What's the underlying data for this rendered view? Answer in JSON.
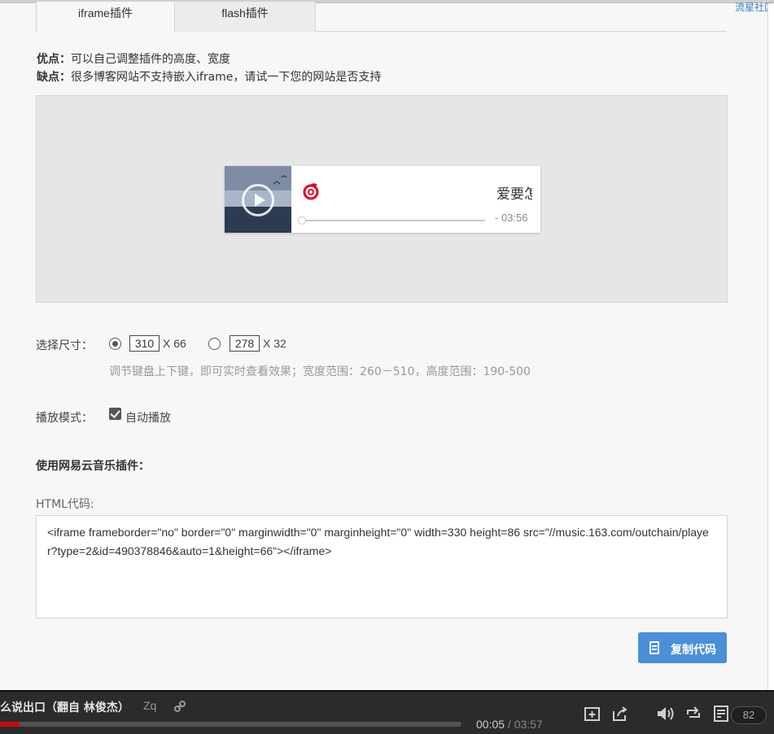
{
  "corner": {
    "link_text": "流星社区"
  },
  "tabs": [
    {
      "label": "iframe插件",
      "active": true
    },
    {
      "label": "flash插件",
      "active": false
    }
  ],
  "pros": {
    "adv_label": "优点：",
    "adv_text": "可以自己调整插件的高度、宽度",
    "dis_label": "缺点：",
    "dis_text": "很多博客网站不支持嵌入iframe，请试一下您的网站是否支持"
  },
  "player": {
    "title": "爱要怎么说出口",
    "time": "- 03:56",
    "progress": 0,
    "brand_color": "#e60026"
  },
  "size": {
    "label": "选择尺寸：",
    "options": [
      {
        "width": "310",
        "height_text": "X 66",
        "selected": true
      },
      {
        "width": "278",
        "height_text": "X 32",
        "selected": false
      }
    ],
    "hint": "调节键盘上下键，即可实时查看效果；宽度范围：260－510，高度范围：190-500"
  },
  "mode": {
    "label": "播放模式：",
    "autoplay_label": "自动播放",
    "autoplay_checked": true
  },
  "section": {
    "title": "使用网易云音乐插件："
  },
  "code": {
    "label": "HTML代码:",
    "value": "<iframe frameborder=\"no\" border=\"0\" marginwidth=\"0\" marginheight=\"0\" width=330 height=86 src=\"//music.163.com/outchain/player?type=2&id=490378846&auto=1&height=66\"></iframe>"
  },
  "copy_button": {
    "label": "复制代码"
  },
  "bottom_bar": {
    "now_playing": "么说出口（翻自 林俊杰）",
    "artist": "Zq",
    "elapsed": "00:05",
    "separator": " / ",
    "total": "03:57",
    "playlist_count": "82",
    "progress_color": "#c70c0c",
    "progress": 0.021
  }
}
